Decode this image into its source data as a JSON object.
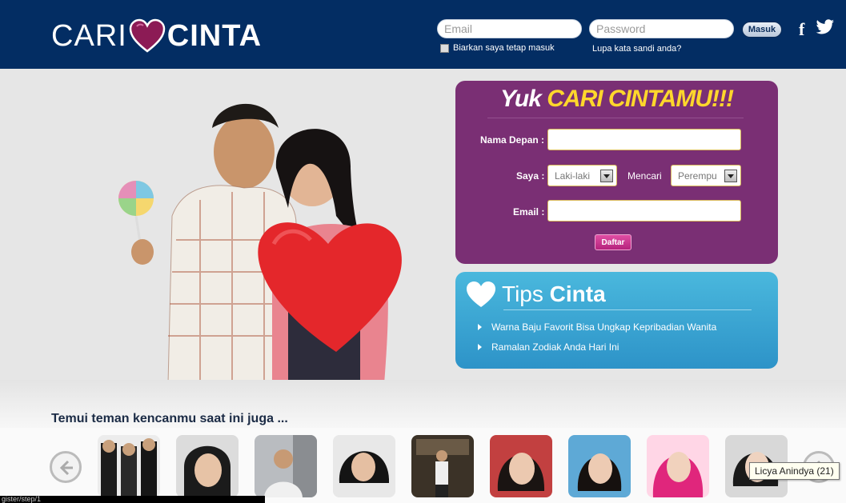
{
  "logo": {
    "word1": "CARI",
    "word2": "CINTA"
  },
  "login": {
    "email_placeholder": "Email",
    "password_placeholder": "Password",
    "submit_label": "Masuk",
    "remember_label": "Biarkan saya tetap masuk",
    "forgot_label": "Lupa kata sandi anda?"
  },
  "social": {
    "facebook_icon": "facebook-icon",
    "twitter_icon": "twitter-icon",
    "facebook_glyph": "f"
  },
  "register": {
    "title_prefix": "Yuk ",
    "title_highlight": "CARI CINTAMU!!!",
    "first_name_label": "Nama Depan :",
    "gender_label": "Saya :",
    "gender_value": "Laki-laki",
    "seeking_label": "Mencari",
    "seeking_value": "Perempu",
    "email_label": "Email :",
    "submit_label": "Daftar"
  },
  "tips": {
    "title_prefix": "Tips ",
    "title_bold": "Cinta",
    "items": [
      "Warna Baju Favorit Bisa Ungkap Kepribadian Wanita",
      "Ramalan Zodiak Anda Hari Ini"
    ]
  },
  "members": {
    "heading": "Temui teman kencanmu saat ini juga ...",
    "tooltip": "Licya Anindya (21)"
  },
  "status_bar": "gister/step/1",
  "colors": {
    "header_bg": "#032d63",
    "register_bg": "#7a2f74",
    "title_highlight": "#ffd72c",
    "tips_bg": "#3aa6d4",
    "daftar_bg": "#c8338f"
  }
}
